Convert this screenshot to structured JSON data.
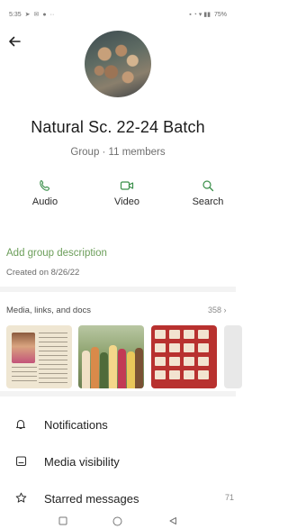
{
  "status_bar": {
    "time": "5:35",
    "right": "75%"
  },
  "group": {
    "name": "Natural Sc. 22-24 Batch",
    "subtitle": "Group · 11 members"
  },
  "actions": {
    "audio_label": "Audio",
    "video_label": "Video",
    "search_label": "Search"
  },
  "description": {
    "add_label": "Add group description",
    "created": "Created on 8/26/22"
  },
  "media": {
    "heading": "Media, links, and docs",
    "count": "358 ›"
  },
  "settings": {
    "notifications_label": "Notifications",
    "media_visibility_label": "Media visibility",
    "starred_label": "Starred messages",
    "starred_value": "71"
  },
  "colors": {
    "accent_green": "#6c9e5a",
    "icon_green": "#3a8f4a",
    "divider": "#f3f3f3"
  },
  "icons": {
    "back": "arrow-back-icon",
    "audio": "phone-icon",
    "video": "video-camera-icon",
    "search": "search-icon",
    "notifications": "bell-icon",
    "media_visibility": "media-visibility-icon",
    "starred": "star-icon"
  }
}
